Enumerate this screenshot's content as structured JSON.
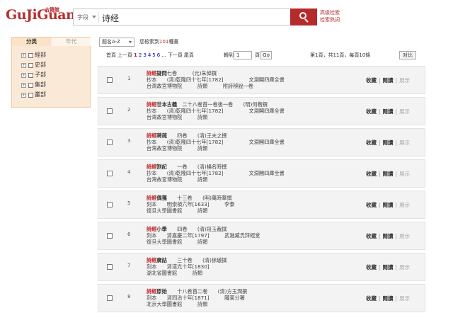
{
  "logo": {
    "en": "GuJiGuan",
    "cn": "古籍館"
  },
  "search": {
    "scope": "字段",
    "query": "诗经",
    "adv1": "高级检索",
    "adv2": "检索熱詞"
  },
  "sidebar": {
    "tab1": "分类",
    "tab2": "年代",
    "items": [
      {
        "label": "經部"
      },
      {
        "label": "史部"
      },
      {
        "label": "子部"
      },
      {
        "label": "集部"
      },
      {
        "label": "叢部"
      }
    ]
  },
  "toolbar": {
    "sort": "题名A-Z",
    "found_pre": "您檢索到",
    "found_num": "101",
    "found_post": "種書"
  },
  "pager": {
    "first": "首頁",
    "prev": "上一頁",
    "pages": [
      "1",
      "2",
      "3",
      "4",
      "5",
      "6"
    ],
    "ellipsis": "...",
    "next": "下一頁",
    "last": "尾頁",
    "jump": "轉到",
    "jump_value": "1",
    "jump_unit": "頁",
    "go": "Go",
    "info": "第1頁，共11頁，每頁10條",
    "compare": "对比"
  },
  "actions": {
    "collect": "收藏",
    "read": "閱讀",
    "display": "展示"
  },
  "results": [
    {
      "idx": "1",
      "kw": "詩經",
      "title": "疑問",
      "l1rest": "七卷　　　(元)朱倬撰",
      "l2": "抄本　　(清)乾隆四十七年[1782]　　　　　文淵閣四庫全書",
      "l3": "台灣故宮博物院　　　詩類　　　附詩辨說一卷"
    },
    {
      "idx": "2",
      "kw": "詩經",
      "title": "世本古義",
      "l1rest": "　二十八卷首一卷後一卷　　(明)何楷撰",
      "l2": "抄本　　(清)乾隆四十七年[1782]　　　　　文淵閣四庫全書",
      "l3": "台灣故宮博物院　　　詩類"
    },
    {
      "idx": "3",
      "kw": "詩經",
      "title": "稗疏",
      "l1rest": "　　四卷　　(清)王夫之撰",
      "l2": "抄本　　(清)乾隆四十七年[1782]　　　　　文淵閣四庫全書",
      "l3": "台灣故宮博物院　　　詩類"
    },
    {
      "idx": "4",
      "kw": "詩經",
      "title": "劄記",
      "l1rest": "　　一卷　　(清)楊名時撰",
      "l2": "抄本　　(清)乾隆四十七年[1782]　　　　　文淵閣四庫全書",
      "l3": "台灣故宮博物院　　　詩類"
    },
    {
      "idx": "5",
      "kw": "詩經",
      "title": "偶箋",
      "l1rest": "　　十三卷　　(明)萬時華撰",
      "l2": "刻本　　明崇禎六年[1633]　　　李泰",
      "l3": "復旦大學圖書館　　　詩類"
    },
    {
      "idx": "6",
      "kw": "詩經",
      "title": "小學",
      "l1rest": "　　四卷　　(清)段玉裁撰",
      "l2": "刻本　　清嘉慶二年[1797]　　　武進臧氏拜經堂",
      "l3": "復旦大學圖書館　　　詩類"
    },
    {
      "idx": "7",
      "kw": "詩經",
      "title": "廣詁",
      "l1rest": "　　三十卷　　(清)徐璈撰",
      "l2": "刻本　　清道光十年[1830]",
      "l3": "湖北省圖書館　　　詩類"
    },
    {
      "idx": "8",
      "kw": "詩經",
      "title": "原始",
      "l1rest": "　　十八卷首二卷　　(清)方玉潤撰",
      "l2": "刻本　　清同治十年[1871]　　　隴東分署",
      "l3": "北京大學圖書館　　　詩類"
    }
  ]
}
